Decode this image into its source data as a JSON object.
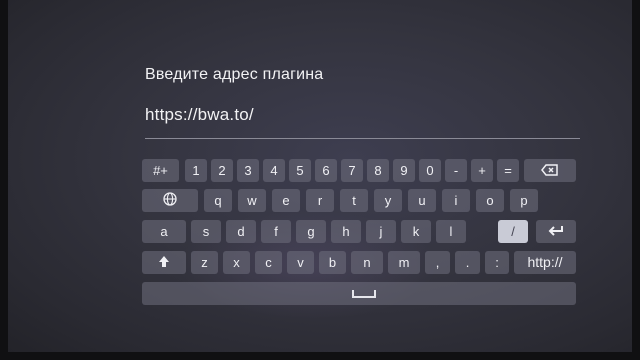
{
  "prompt": {
    "title": "Введите адрес плагина"
  },
  "input": {
    "value": "https://bwa.to/"
  },
  "keyboard": {
    "row1": [
      "#+",
      "1",
      "2",
      "3",
      "4",
      "5",
      "6",
      "7",
      "8",
      "9",
      "0",
      "-",
      "+",
      "="
    ],
    "row2": [
      "q",
      "w",
      "e",
      "r",
      "t",
      "y",
      "u",
      "i",
      "o",
      "p"
    ],
    "row3": [
      "a",
      "s",
      "d",
      "f",
      "g",
      "h",
      "j",
      "k",
      "l",
      "/"
    ],
    "row4": [
      "z",
      "x",
      "c",
      "v",
      "b",
      "n",
      "m",
      ",",
      ".",
      ":",
      "http://"
    ],
    "selected_key": "/",
    "icons": {
      "backspace": "backspace-icon",
      "language": "globe-icon",
      "enter": "enter-icon",
      "shift": "shift-icon",
      "space": "space-icon"
    }
  }
}
